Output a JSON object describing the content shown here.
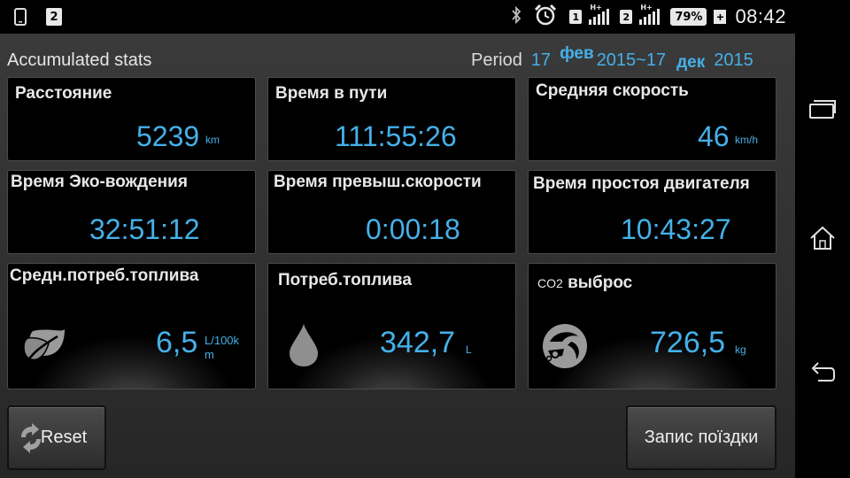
{
  "status_bar": {
    "sim_badge": "2",
    "sim1_label": "1",
    "sim2_label": "2",
    "network_type": "H+",
    "battery": "79%",
    "time": "08:42",
    "icons": [
      "phone-icon",
      "bluetooth-icon",
      "alarm-icon",
      "signal-icon",
      "battery-icon",
      "charging-icon"
    ]
  },
  "header": {
    "title": "Accumulated stats",
    "period_label": "Period",
    "period_start_day": "17",
    "period_start_month": "фев",
    "period_start_year_sep": "2015~17",
    "period_end_month": "дек",
    "period_end_year": "2015"
  },
  "cards": {
    "distance": {
      "title": "Расстояние",
      "value": "5239",
      "unit": "km"
    },
    "travel_time": {
      "title": "Время в пути",
      "value": "111:55:26"
    },
    "avg_speed": {
      "title": "Средняя скорость",
      "value": "46",
      "unit": "km/h"
    },
    "eco_time": {
      "title": "Время Эко-вождения",
      "value": "32:51:12"
    },
    "overspeed_time": {
      "title": "Время превыш.скорости",
      "value": "0:00:18"
    },
    "idle_time": {
      "title": "Время простоя двигателя",
      "value": "10:43:27"
    },
    "avg_fuel": {
      "title": "Средн.потреб.топлива",
      "value": "6,5",
      "unit_line1": "L/100k",
      "unit_line2": "m",
      "icon": "leaf-icon"
    },
    "fuel": {
      "title": "Потреб.топлива",
      "value": "342,7",
      "unit": "L",
      "icon": "drop-icon"
    },
    "co2": {
      "title_prefix": "CO2",
      "title": "выброс",
      "value": "726,5",
      "unit": "kg",
      "icon": "co2-exhaust-icon"
    }
  },
  "buttons": {
    "reset": "Reset",
    "trip_record": "Запис поїздки"
  },
  "colors": {
    "accent": "#45b0e8",
    "card_bg": "#000000",
    "app_bg": "#333333",
    "title_text": "#e8e8e8"
  }
}
